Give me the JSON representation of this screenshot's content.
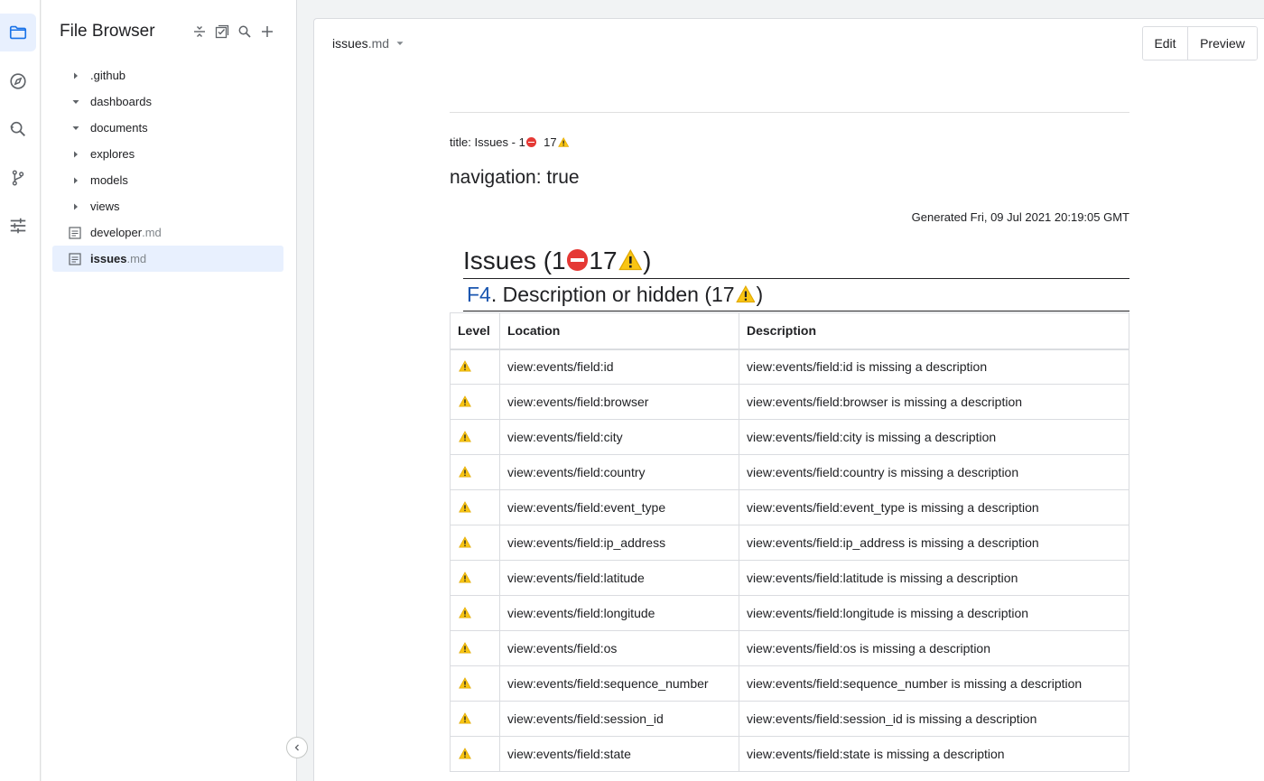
{
  "rail": {
    "icons": [
      "folder-icon",
      "compass-icon",
      "search-history-icon",
      "branch-icon",
      "sliders-icon"
    ]
  },
  "browser": {
    "title": "File Browser",
    "items": [
      {
        "name": ".github",
        "ext": "",
        "type": "folder",
        "expanded": false
      },
      {
        "name": "dashboards",
        "ext": "",
        "type": "folder",
        "expanded": true
      },
      {
        "name": "documents",
        "ext": "",
        "type": "folder",
        "expanded": true
      },
      {
        "name": "explores",
        "ext": "",
        "type": "folder",
        "expanded": false
      },
      {
        "name": "models",
        "ext": "",
        "type": "folder",
        "expanded": false
      },
      {
        "name": "views",
        "ext": "",
        "type": "folder",
        "expanded": false
      },
      {
        "name": "developer",
        "ext": ".md",
        "type": "file",
        "selected": false
      },
      {
        "name": "issues",
        "ext": ".md",
        "type": "file",
        "selected": true
      }
    ]
  },
  "editor": {
    "file_name": "issues",
    "file_ext": ".md",
    "edit_label": "Edit",
    "preview_label": "Preview"
  },
  "doc": {
    "title_prefix": "title: Issues - 1",
    "title_count_warn": "17",
    "navigation": "navigation: true",
    "generated": "Generated Fri, 09 Jul 2021 20:19:05 GMT",
    "heading_prefix": "Issues (1",
    "heading_warn_count": "17",
    "heading_suffix": ")",
    "section_link": "F4",
    "section_text": ". Description or hidden (17",
    "section_suffix": ")",
    "columns": [
      "Level",
      "Location",
      "Description"
    ],
    "rows": [
      {
        "location": "view:events/field:id",
        "description": "view:events/field:id is missing a description"
      },
      {
        "location": "view:events/field:browser",
        "description": "view:events/field:browser is missing a description"
      },
      {
        "location": "view:events/field:city",
        "description": "view:events/field:city is missing a description"
      },
      {
        "location": "view:events/field:country",
        "description": "view:events/field:country is missing a description"
      },
      {
        "location": "view:events/field:event_type",
        "description": "view:events/field:event_type is missing a description"
      },
      {
        "location": "view:events/field:ip_address",
        "description": "view:events/field:ip_address is missing a description"
      },
      {
        "location": "view:events/field:latitude",
        "description": "view:events/field:latitude is missing a description"
      },
      {
        "location": "view:events/field:longitude",
        "description": "view:events/field:longitude is missing a description"
      },
      {
        "location": "view:events/field:os",
        "description": "view:events/field:os is missing a description"
      },
      {
        "location": "view:events/field:sequence_number",
        "description": "view:events/field:sequence_number is missing a description"
      },
      {
        "location": "view:events/field:session_id",
        "description": "view:events/field:session_id is missing a description"
      },
      {
        "location": "view:events/field:state",
        "description": "view:events/field:state is missing a description"
      }
    ]
  },
  "colors": {
    "accent": "#1a73e8",
    "selected_bg": "#e8f0fe",
    "link": "#1a56b0",
    "warn": "#f9c513",
    "error": "#e53935"
  }
}
